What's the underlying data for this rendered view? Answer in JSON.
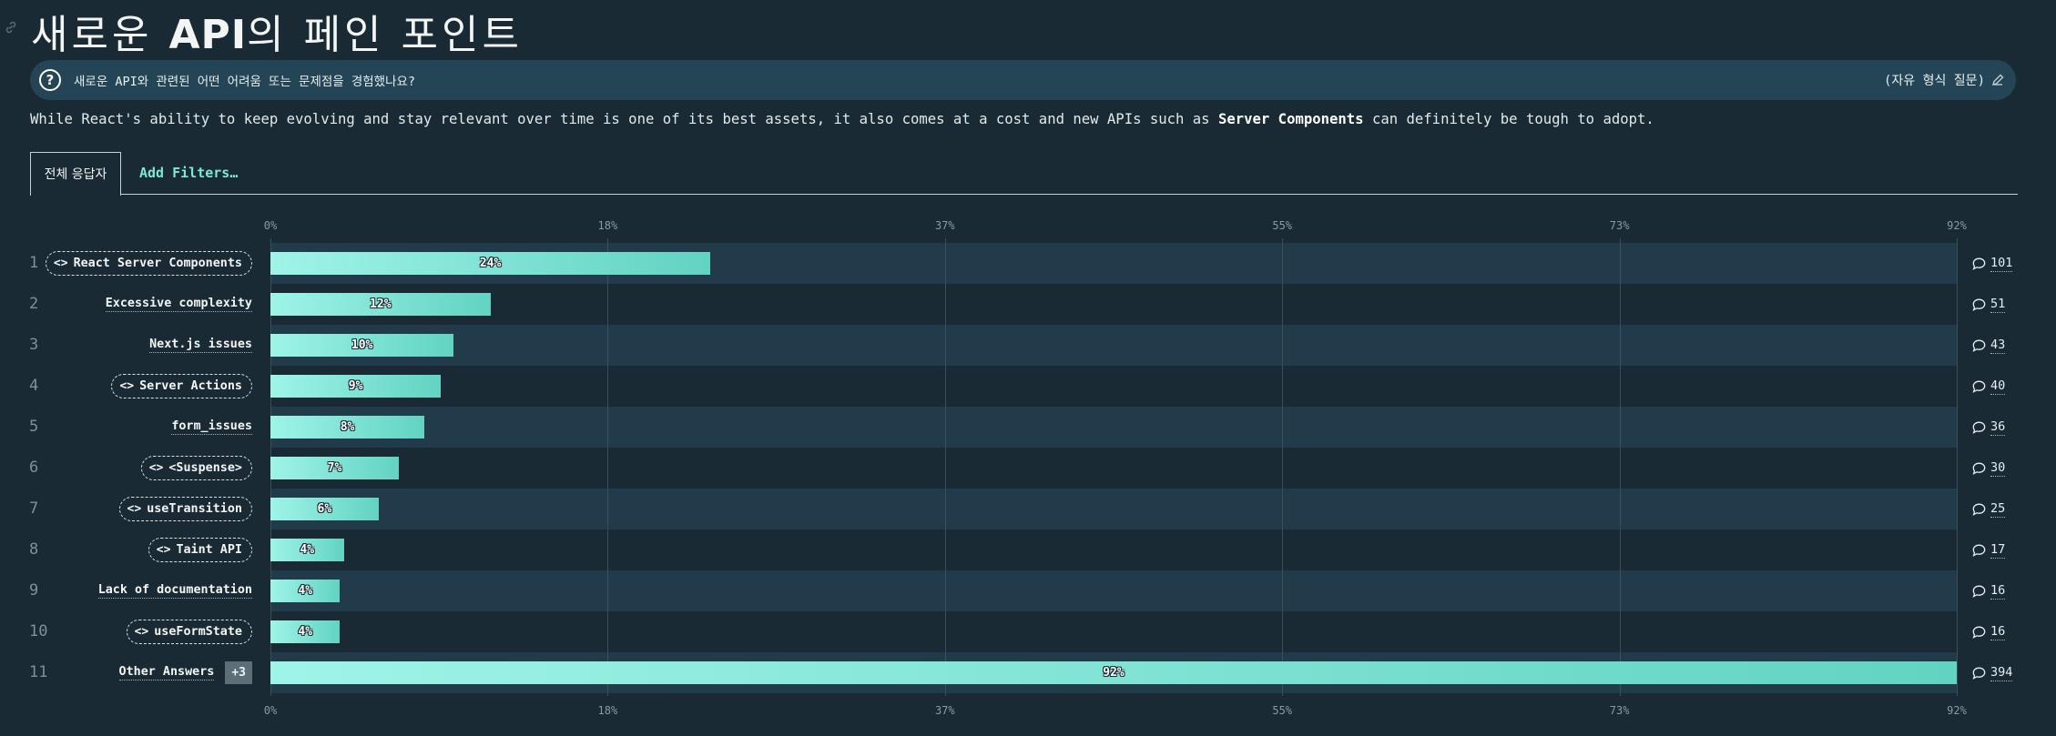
{
  "header": {
    "title_prefix": "새로운 ",
    "title_bold": "API",
    "title_suffix": "의 페인 포인트"
  },
  "question": {
    "text": "새로운 API와 관련된 어떤 어려움 또는 문제점을 경험했나요?",
    "type_label": "(자유 형식 질문)"
  },
  "description": {
    "before": "While React's ability to keep evolving and stay relevant over time is one of its best assets, it also comes at a cost and new APIs such as ",
    "bold": "Server Components",
    "after": " can definitely be tough to adopt."
  },
  "tabs": {
    "active": "전체 응답자",
    "filter": "Add Filters…"
  },
  "colors": {
    "background": "#1a2a34",
    "bar_start": "#9ff4e8",
    "bar_end": "#62d3c2",
    "row_alt": "#213b4a"
  },
  "chart_data": {
    "type": "bar",
    "orientation": "horizontal",
    "xlim": [
      0,
      92
    ],
    "x_ticks": [
      "0%",
      "18%",
      "37%",
      "55%",
      "73%",
      "92%"
    ],
    "x_tick_values": [
      0,
      18.4,
      36.8,
      55.2,
      73.6,
      92
    ],
    "grid": true,
    "rows": [
      {
        "rank": "1",
        "label": "React Server Components",
        "pill": true,
        "value": 24,
        "value_label": "24%",
        "count": "101"
      },
      {
        "rank": "2",
        "label": "Excessive complexity",
        "pill": false,
        "value": 12,
        "value_label": "12%",
        "count": "51"
      },
      {
        "rank": "3",
        "label": "Next.js issues",
        "pill": false,
        "value": 10,
        "value_label": "10%",
        "count": "43"
      },
      {
        "rank": "4",
        "label": "Server Actions",
        "pill": true,
        "value": 9.3,
        "value_label": "9%",
        "count": "40"
      },
      {
        "rank": "5",
        "label": "form_issues",
        "pill": false,
        "value": 8.4,
        "value_label": "8%",
        "count": "36"
      },
      {
        "rank": "6",
        "label": "<Suspense>",
        "pill": true,
        "value": 7,
        "value_label": "7%",
        "count": "30"
      },
      {
        "rank": "7",
        "label": "useTransition",
        "pill": true,
        "value": 5.9,
        "value_label": "6%",
        "count": "25"
      },
      {
        "rank": "8",
        "label": "Taint API",
        "pill": true,
        "value": 4,
        "value_label": "4%",
        "count": "17"
      },
      {
        "rank": "9",
        "label": "Lack of documentation",
        "pill": false,
        "value": 3.8,
        "value_label": "4%",
        "count": "16"
      },
      {
        "rank": "10",
        "label": "useFormState",
        "pill": true,
        "value": 3.8,
        "value_label": "4%",
        "count": "16"
      },
      {
        "rank": "11",
        "label": "Other Answers",
        "pill": false,
        "badge": "+3",
        "value": 92,
        "value_label": "92%",
        "count": "394"
      }
    ]
  }
}
